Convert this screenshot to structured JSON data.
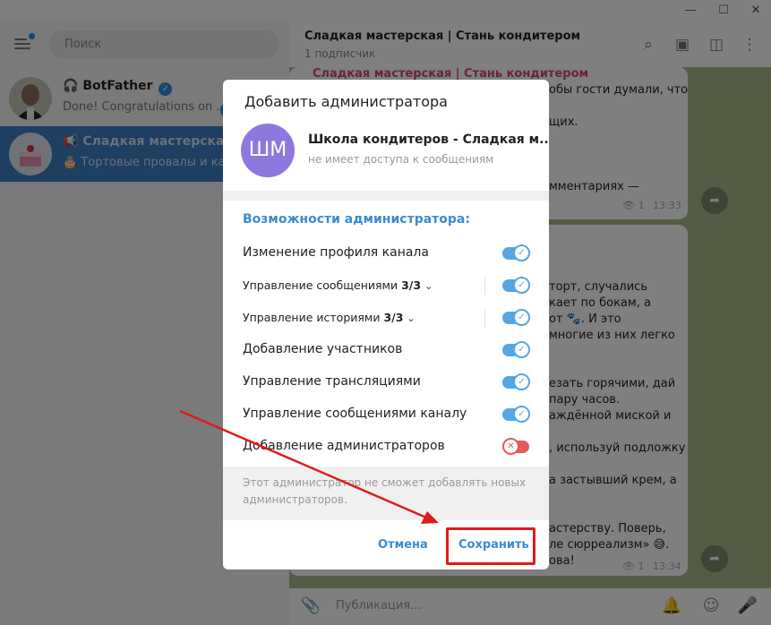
{
  "window": {
    "minimize_glyph": "—",
    "maximize_glyph": "☐",
    "close_glyph": "✕"
  },
  "sidebar": {
    "search_placeholder": "Поиск",
    "chats": [
      {
        "name": "BotFather",
        "message": "Done! Congratulations on ...",
        "icon": "bot-icon",
        "verified": true
      },
      {
        "name": "Сладкая мастерская | Ста",
        "message": "🎂 Тортовые провалы и как",
        "icon": "megaphone-icon"
      }
    ]
  },
  "chat": {
    "title": "Сладкая мастерская | Стань кондитером",
    "subtitle": "1 подписчик",
    "message1": {
      "lines": [
        "Сладкая мастерская | Стань кондитером",
        "обы гости думали, что",
        "щих.",
        "мментариях —"
      ],
      "views": "1",
      "time": "13:33"
    },
    "message2": {
      "lines": [
        "торт, случались",
        "кает по бокам, а",
        "от 🐾. И это",
        "многие из них легко",
        "езать горячими, дай",
        "пару часов.",
        "аждённой миской и",
        ", используй подложку",
        "а застывший крем, а",
        "астерству. Поверь,",
        "ле сюрреализм» 😅.",
        "ова!"
      ],
      "views": "1",
      "time": "13:34"
    },
    "compose_placeholder": "Публикация..."
  },
  "dialog": {
    "title": "Добавить администратора",
    "user_initials": "ШМ",
    "user_name": "Школа кондитеров - Сладкая м...",
    "user_status": "не имеет доступа к сообщениям",
    "section_title": "Возможности администратора:",
    "permissions": [
      {
        "label": "Изменение профиля канала",
        "count": "",
        "enabled": true
      },
      {
        "label": "Управление сообщениями",
        "count": "3/3",
        "enabled": true
      },
      {
        "label": "Управление историями",
        "count": "3/3",
        "enabled": true
      },
      {
        "label": "Добавление участников",
        "count": "",
        "enabled": true
      },
      {
        "label": "Управление трансляциями",
        "count": "",
        "enabled": true
      },
      {
        "label": "Управление сообщениями каналу",
        "count": "",
        "enabled": true
      },
      {
        "label": "Добавление администраторов",
        "count": "",
        "enabled": false
      }
    ],
    "note": "Этот администратор не сможет добавлять новых администраторов.",
    "cancel_label": "Отмена",
    "save_label": "Сохранить"
  },
  "colors": {
    "accent": "#3a8bd0",
    "toggle_on": "#56a6e6",
    "toggle_off": "#e35b5b",
    "annotation": "#e01b1b",
    "active_chat": "#3a7fc2"
  }
}
